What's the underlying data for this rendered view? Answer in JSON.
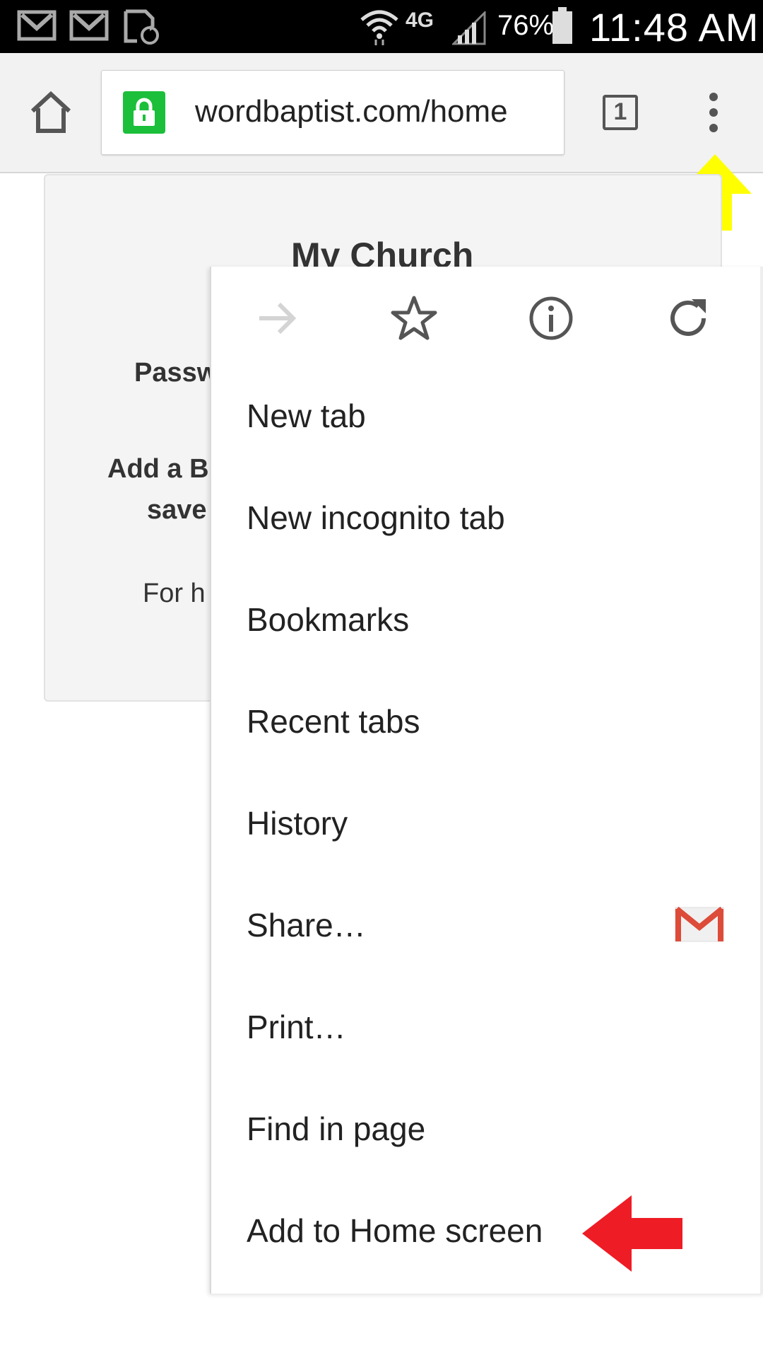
{
  "status_bar": {
    "icons": [
      "gmail-icon",
      "gmail-icon",
      "sync-icon",
      "wifi-icon",
      "4g-lte-icon",
      "signal-icon",
      "battery-icon"
    ],
    "network_label": "4G",
    "battery_percent": "76%",
    "time": "11:48 AM"
  },
  "toolbar": {
    "url": "wordbaptist.com/home",
    "tab_count": "1"
  },
  "page": {
    "title": "My Church",
    "line1": "Passw",
    "line2": "Add a B",
    "line3": "save",
    "line4": "For h"
  },
  "menu": {
    "icon_row": [
      "forward-icon",
      "bookmark-star-icon",
      "info-icon",
      "reload-icon"
    ],
    "items": [
      {
        "label": "New tab"
      },
      {
        "label": "New incognito tab"
      },
      {
        "label": "Bookmarks"
      },
      {
        "label": "Recent tabs"
      },
      {
        "label": "History"
      },
      {
        "label": "Share…"
      },
      {
        "label": "Print…"
      },
      {
        "label": "Find in page"
      },
      {
        "label": "Add to Home screen"
      }
    ]
  },
  "colors": {
    "annotation_yellow": "#ffff00",
    "annotation_red": "#ee1c25",
    "lock_green": "#1bbf3a"
  }
}
